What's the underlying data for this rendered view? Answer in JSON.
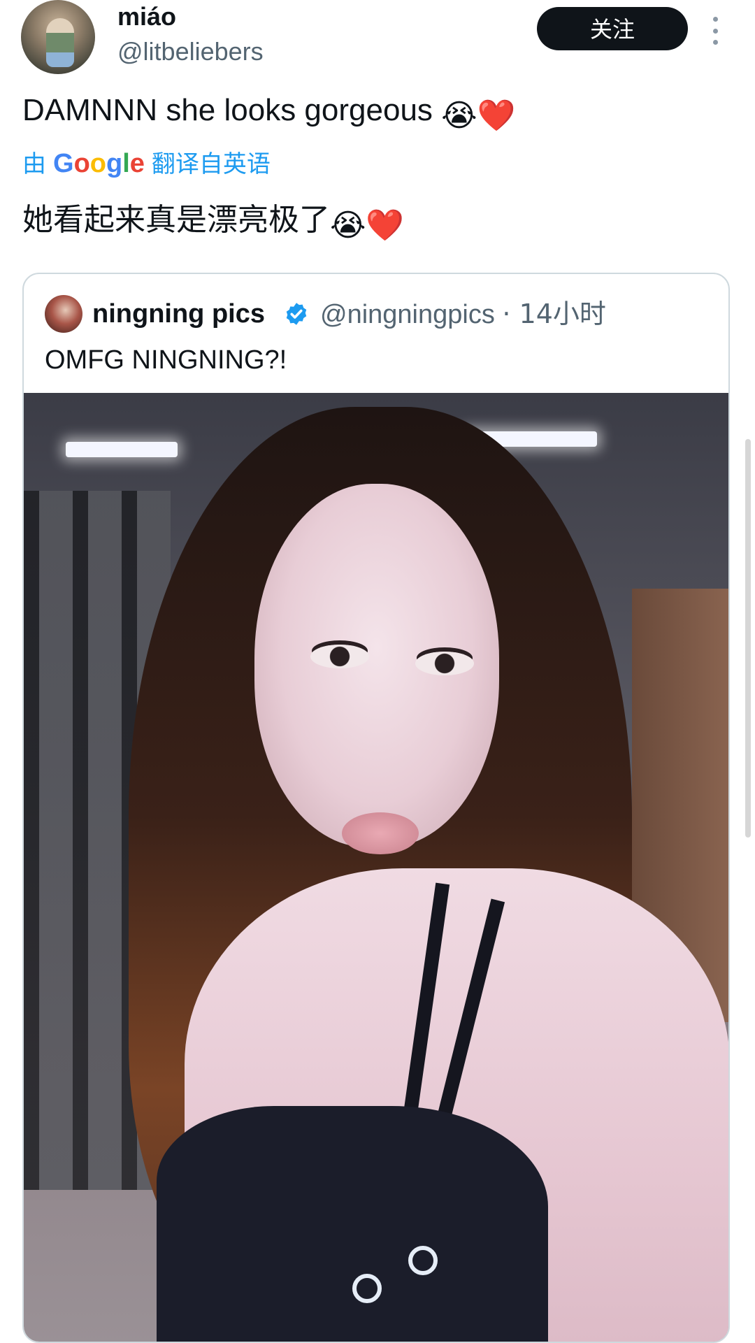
{
  "tweet": {
    "author": {
      "name": "miáo",
      "handle": "@litbeliebers"
    },
    "follow_label": "关注",
    "text": "DAMNNN she looks gorgeous",
    "text_emoji": "😭❤️",
    "translation": {
      "prefix": "由",
      "service": "Google",
      "suffix": "翻译自英语",
      "text": "她看起来真是漂亮极了",
      "text_emoji": "😭❤️"
    }
  },
  "quoted_tweet": {
    "name": "ningning pics",
    "handle": "@ningningpics",
    "time": "· 14小时",
    "text": "OMFG NINGNING?!"
  },
  "icons": {
    "more": "more-vertical-icon",
    "verified": "verified-badge-icon"
  },
  "colors": {
    "link": "#1d9bf0",
    "verified": "#1d9bf0",
    "follow_bg": "#0f1419",
    "muted": "#536471"
  }
}
